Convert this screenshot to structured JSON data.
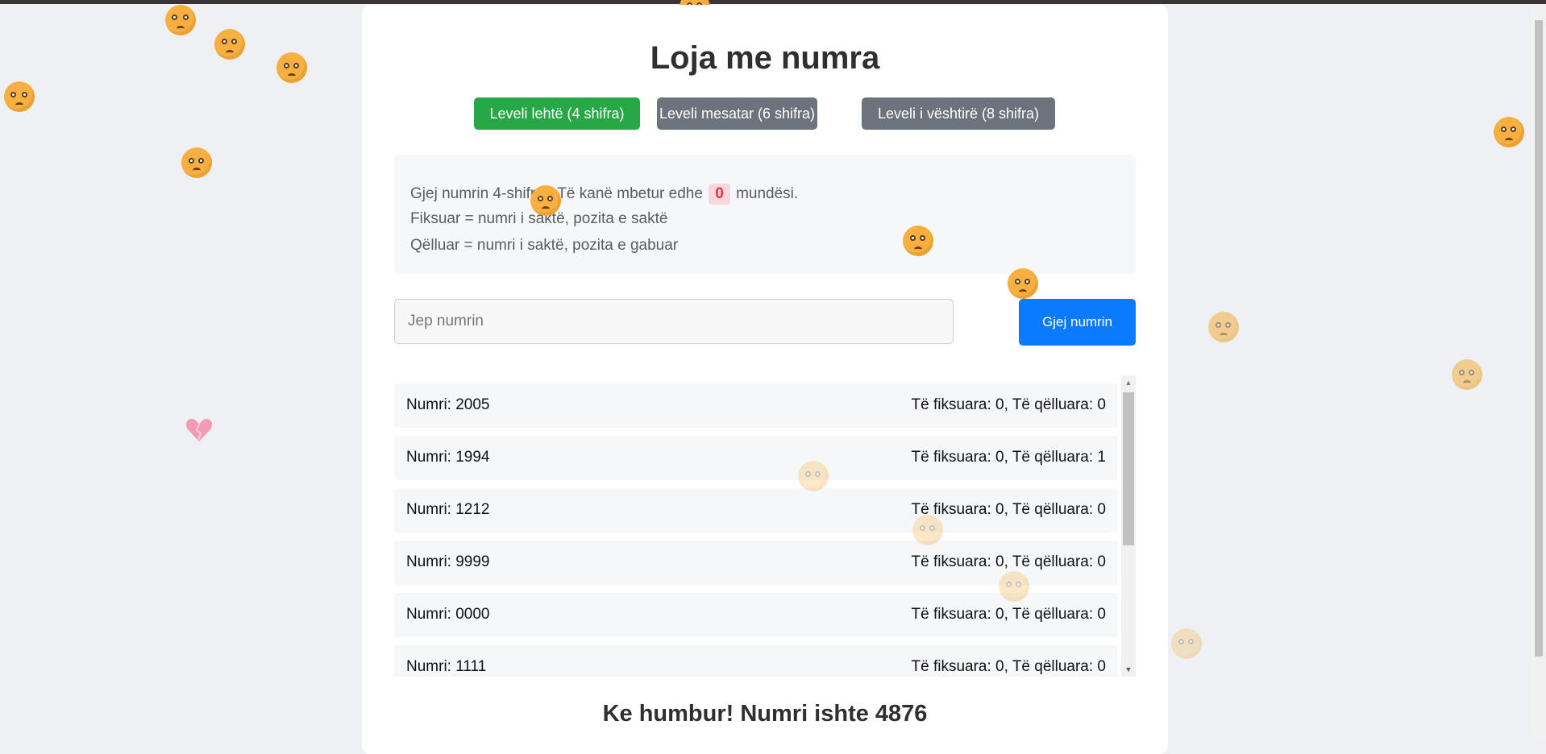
{
  "game": {
    "title": "Loja me numra",
    "levels": [
      {
        "label": "Leveli lehtë (4 shifra)",
        "active": true
      },
      {
        "label": "Leveli mesatar (6 shifra)",
        "active": false
      },
      {
        "label": "Leveli i vështirë (8 shifra)",
        "active": false
      }
    ],
    "info": {
      "line1_before": "Gjej numrin 4-shifror! Të kanë mbetur edhe",
      "remaining": "0",
      "line1_after": "mundësi.",
      "line2": "Fiksuar = numri i saktë, pozita e saktë",
      "line3": "Qëlluar = numri i saktë, pozita e gabuar"
    },
    "input": {
      "placeholder": "Jep numrin",
      "value": ""
    },
    "guess_button": "Gjej numrin",
    "history": [
      {
        "number": "Numri: 2005",
        "result": "Të fiksuara: 0, Të qëlluara: 0"
      },
      {
        "number": "Numri: 1994",
        "result": "Të fiksuara: 0, Të qëlluara: 1"
      },
      {
        "number": "Numri: 1212",
        "result": "Të fiksuara: 0, Të qëlluara: 0"
      },
      {
        "number": "Numri: 9999",
        "result": "Të fiksuara: 0, Të qëlluara: 0"
      },
      {
        "number": "Numri: 0000",
        "result": "Të fiksuara: 0, Të qëlluara: 0"
      },
      {
        "number": "Numri: 1111",
        "result": "Të fiksuara: 0, Të qëlluara: 0"
      }
    ],
    "result_message": "Ke humbur! Numri ishte 4876"
  },
  "decorations": {
    "falling_icons": [
      "crying-face-icon",
      "sad-face-icon",
      "anxious-face-icon",
      "broken-heart-icon"
    ]
  },
  "colors": {
    "active_level": "#27a745",
    "inactive_level": "#6b747c",
    "primary_button": "#0a7bff",
    "remaining_badge_text": "#dc3545"
  }
}
